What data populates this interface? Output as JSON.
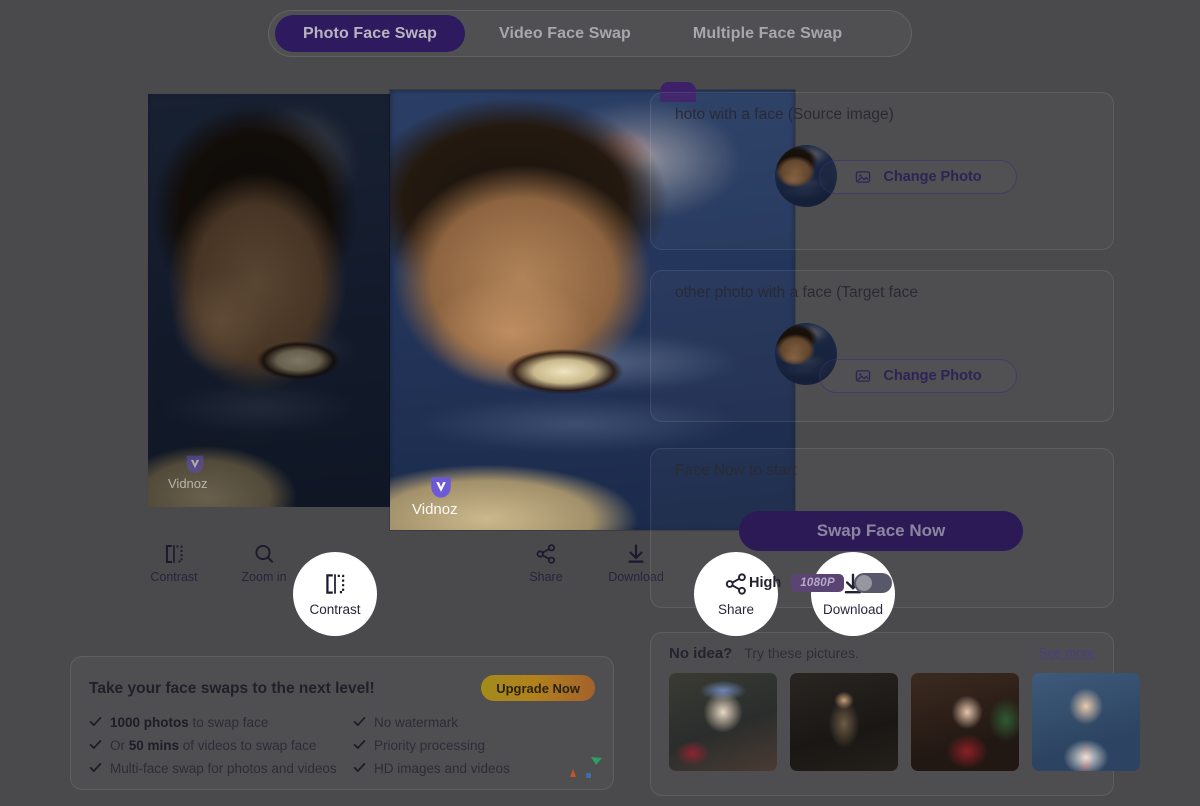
{
  "theme": {
    "page_bg": "#4a4a4d",
    "accent_purple": "#2e1a5e",
    "swap_button": "#2b1a56",
    "upgrade_gold": "#b1821c",
    "badge_purple": "#5a4474"
  },
  "tabs": [
    {
      "label": "Photo Face Swap",
      "active": true
    },
    {
      "label": "Video Face Swap",
      "active": false
    },
    {
      "label": "Multiple Face Swap",
      "active": false
    }
  ],
  "preview": {
    "base_watermark": "Vidnoz",
    "overlay_watermark": "Vidnoz"
  },
  "toolbar": {
    "items": [
      {
        "icon": "contrast-icon",
        "label": "Contrast"
      },
      {
        "icon": "zoom-in-icon",
        "label": "Zoom in"
      },
      {
        "icon": "share-icon",
        "label": "Share"
      },
      {
        "icon": "download-icon",
        "label": "Download"
      }
    ],
    "bubbles": [
      {
        "icon": "contrast-icon",
        "label": "Contrast"
      },
      {
        "icon": "share-icon",
        "label": "Share"
      },
      {
        "icon": "download-icon",
        "label": "Download"
      }
    ]
  },
  "panel": {
    "source": {
      "title": "hoto with a face (Source image)",
      "change_label": "Change Photo"
    },
    "target": {
      "title": "other photo with a face (Target face",
      "change_label": "Change Photo"
    },
    "action": {
      "hint": "Face Now to start",
      "swap_label": "Swap Face Now",
      "quality_label": "High",
      "resolution_badge": "1080P",
      "toggle_state": "off"
    },
    "ideas": {
      "title": "No idea?",
      "subtitle": "Try these pictures.",
      "see_more": "See more",
      "thumbnails": [
        {
          "name": "idea-thumb-fantasy-queen"
        },
        {
          "name": "idea-thumb-warrior-woman"
        },
        {
          "name": "idea-thumb-christmas-girl"
        },
        {
          "name": "idea-thumb-school-uniform"
        }
      ]
    }
  },
  "promo": {
    "title": "Take your face swaps to the next level!",
    "upgrade_label": "Upgrade Now",
    "column_1": [
      {
        "strong": "1000 photos",
        "rest": " to swap face"
      },
      {
        "prefix": "Or ",
        "strong": "50 mins",
        "rest": " of videos to swap face"
      },
      {
        "strong": "",
        "rest": "Multi-face swap for photos and videos"
      }
    ],
    "column_2": [
      {
        "strong": "",
        "rest": "No watermark"
      },
      {
        "strong": "",
        "rest": "Priority processing"
      },
      {
        "strong": "",
        "rest": "HD images and videos"
      }
    ]
  }
}
